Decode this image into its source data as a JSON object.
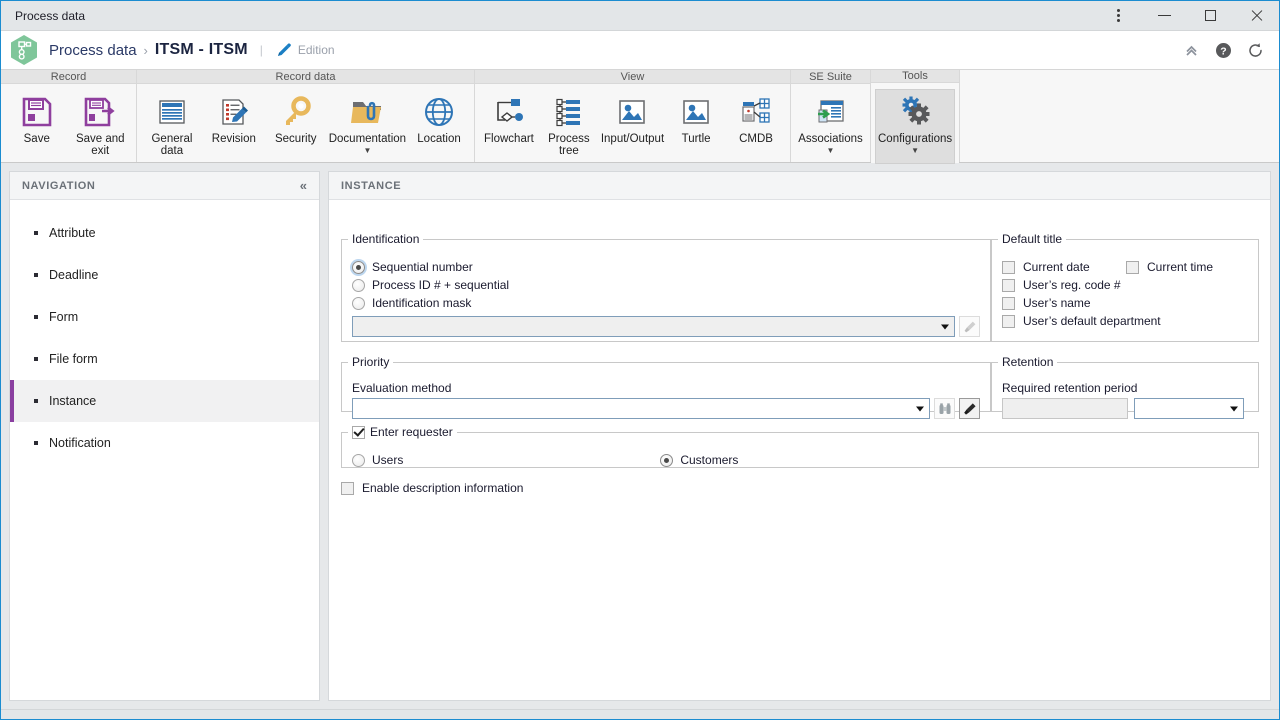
{
  "window": {
    "title": "Process data",
    "controls": {
      "more_label": "More options",
      "minimize_label": "Minimize",
      "maximize_label": "Maximize",
      "close_label": "Close"
    }
  },
  "header": {
    "breadcrumb_root": "Process data",
    "breadcrumb_separator": "›",
    "breadcrumb_current": "ITSM - ITSM",
    "divider": "|",
    "mode_label": "Edition",
    "icons": {
      "collapse": "chevron-double-up-icon",
      "help": "help-icon",
      "refresh": "refresh-icon"
    }
  },
  "ribbon": {
    "groups": [
      {
        "title": "Record",
        "items": [
          {
            "label": "Save",
            "icon": "save-icon",
            "caret": false,
            "active": false
          },
          {
            "label": "Save and exit",
            "icon": "save-and-exit-icon",
            "caret": false,
            "active": false
          }
        ]
      },
      {
        "title": "Record data",
        "items": [
          {
            "label": "General data",
            "icon": "general-data-icon",
            "caret": false,
            "active": false
          },
          {
            "label": "Revision",
            "icon": "revision-icon",
            "caret": false,
            "active": false
          },
          {
            "label": "Security",
            "icon": "security-key-icon",
            "caret": false,
            "active": false
          },
          {
            "label": "Documentation",
            "icon": "documentation-folder-icon",
            "caret": true,
            "active": false
          },
          {
            "label": "Location",
            "icon": "location-globe-icon",
            "caret": false,
            "active": false
          }
        ]
      },
      {
        "title": "View",
        "items": [
          {
            "label": "Flowchart",
            "icon": "flowchart-icon",
            "caret": false,
            "active": false
          },
          {
            "label": "Process tree",
            "icon": "process-tree-icon",
            "caret": false,
            "active": false
          },
          {
            "label": "Input/Output",
            "icon": "input-output-image-icon",
            "caret": false,
            "active": false
          },
          {
            "label": "Turtle",
            "icon": "turtle-image-icon",
            "caret": false,
            "active": false
          },
          {
            "label": "CMDB",
            "icon": "cmdb-icon",
            "caret": false,
            "active": false
          }
        ]
      },
      {
        "title": "SE Suite",
        "items": [
          {
            "label": "Associations",
            "icon": "associations-icon",
            "caret": true,
            "active": false
          }
        ]
      },
      {
        "title": "Tools",
        "items": [
          {
            "label": "Configurations",
            "icon": "configurations-gears-icon",
            "caret": true,
            "active": true
          }
        ]
      }
    ]
  },
  "navigation": {
    "title": "NAVIGATION",
    "collapse_icon": "«",
    "items": [
      {
        "label": "Attribute",
        "selected": false
      },
      {
        "label": "Deadline",
        "selected": false
      },
      {
        "label": "Form",
        "selected": false
      },
      {
        "label": "File form",
        "selected": false
      },
      {
        "label": "Instance",
        "selected": true
      },
      {
        "label": "Notification",
        "selected": false
      }
    ]
  },
  "content": {
    "title": "INSTANCE",
    "identification": {
      "legend": "Identification",
      "options": [
        {
          "label": "Sequential number",
          "selected": true
        },
        {
          "label": "Process ID # + sequential",
          "selected": false
        },
        {
          "label": "Identification mask",
          "selected": false
        }
      ],
      "combo_value": "",
      "combo_disabled": true,
      "brush_button": "brush-icon"
    },
    "default_title": {
      "legend": "Default title",
      "options": [
        {
          "label": "Current date",
          "checked": false
        },
        {
          "label": "Current time",
          "checked": false
        },
        {
          "label": "User’s reg. code #",
          "checked": false
        },
        {
          "label": "User’s name",
          "checked": false
        },
        {
          "label": "User’s default department",
          "checked": false
        }
      ]
    },
    "priority": {
      "legend": "Priority",
      "field_label": "Evaluation method",
      "combo_value": "",
      "search_button": "binoculars-icon",
      "brush_button": "brush-icon"
    },
    "retention": {
      "legend": "Retention",
      "field_label": "Required retention period",
      "value": "",
      "unit_value": ""
    },
    "requester": {
      "legend": "Enter requester",
      "checked": true,
      "options": [
        {
          "label": "Users",
          "selected": false
        },
        {
          "label": "Customers",
          "selected": true
        }
      ]
    },
    "enable_description": {
      "label": "Enable description information",
      "checked": false
    }
  },
  "colors": {
    "accent_blue": "#1b8cd0",
    "selected_purple": "#8a3fa0",
    "save_purple": "#8f3f9e",
    "icon_blue": "#2e75b6",
    "key_gold": "#e8b85c"
  }
}
